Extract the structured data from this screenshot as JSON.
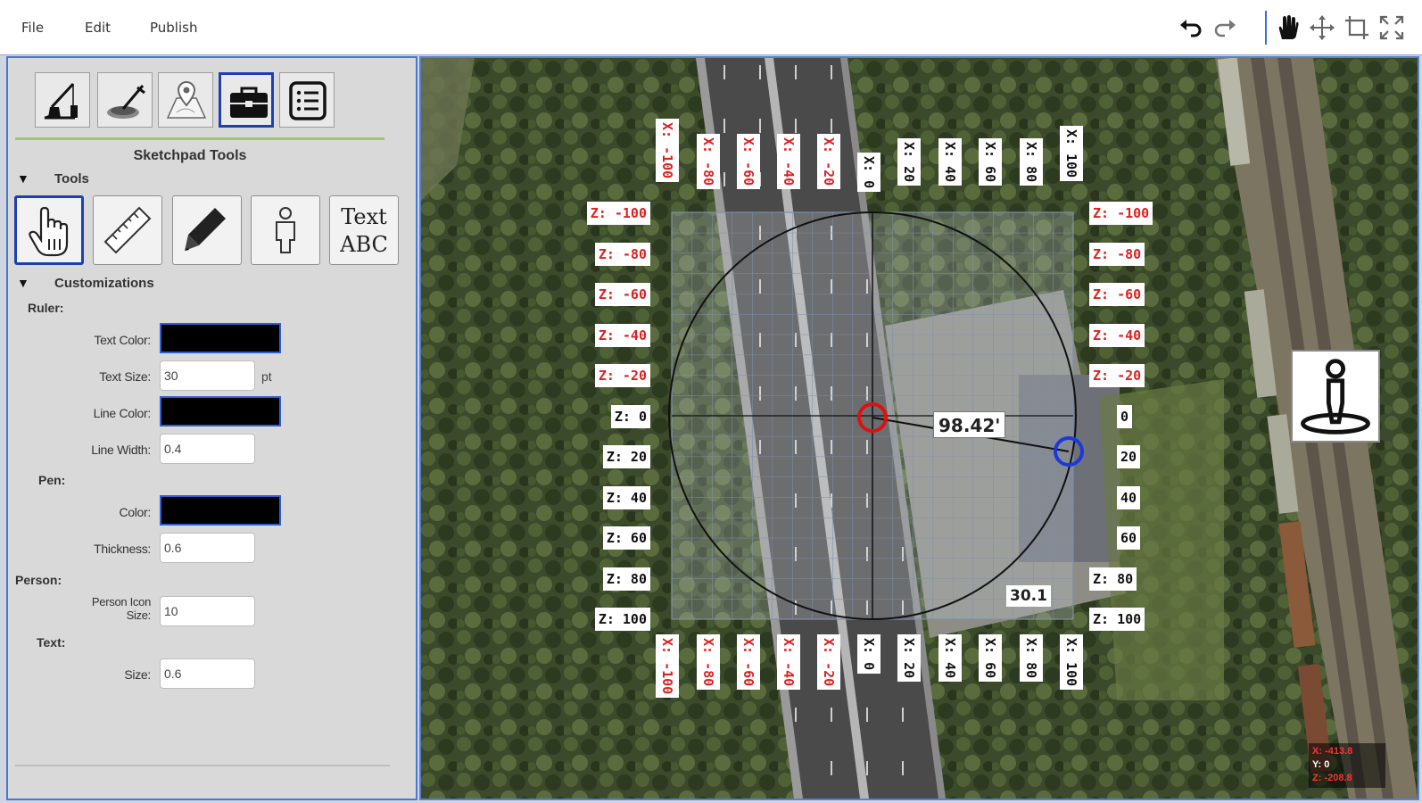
{
  "menu": {
    "file": "File",
    "edit": "Edit",
    "publish": "Publish"
  },
  "toolbar_icons": [
    "undo-icon",
    "redo-icon",
    "hand-pan-icon",
    "move-icon",
    "crop-icon",
    "fullscreen-icon"
  ],
  "panel": {
    "mode_buttons": [
      {
        "icon": "crane-icon",
        "active": false
      },
      {
        "icon": "metal-detector-icon",
        "active": false
      },
      {
        "icon": "map-pin-icon",
        "active": false
      },
      {
        "icon": "toolbox-icon",
        "active": true
      },
      {
        "icon": "list-icon",
        "active": false
      }
    ],
    "title": "Sketchpad Tools",
    "tools_heading": "Tools",
    "tools": [
      {
        "icon": "pointer-hand-icon",
        "active": true
      },
      {
        "icon": "ruler-icon",
        "active": false
      },
      {
        "icon": "pencil-icon",
        "active": false
      },
      {
        "icon": "person-icon",
        "active": false
      },
      {
        "text_line1": "Text",
        "text_line2": "ABC",
        "active": false
      }
    ],
    "customizations_heading": "Customizations",
    "ruler": {
      "label": "Ruler:",
      "text_color_label": "Text Color:",
      "text_color": "#000000",
      "text_size_label": "Text Size:",
      "text_size": "30",
      "text_size_unit": "pt",
      "line_color_label": "Line Color:",
      "line_color": "#000000",
      "line_width_label": "Line Width:",
      "line_width": "0.4"
    },
    "pen": {
      "label": "Pen:",
      "color_label": "Color:",
      "color": "#000000",
      "thickness_label": "Thickness:",
      "thickness": "0.6"
    },
    "person": {
      "label": "Person:",
      "icon_size_label_1": "Person Icon",
      "icon_size_label_2": "Size:",
      "icon_size": "10"
    },
    "text": {
      "label": "Text:",
      "size_label": "Size:",
      "size": "0.6"
    }
  },
  "map": {
    "x_labels": [
      "X: -100",
      "X: -80",
      "X: -60",
      "X: -40",
      "X: -20",
      "X: 0",
      "X: 20",
      "X: 40",
      "X: 60",
      "X: 80",
      "X: 100"
    ],
    "z_labels_left": [
      "Z: -100",
      "Z: -80",
      "Z: -60",
      "Z: -40",
      "Z: -20",
      "Z: 0",
      "Z: 20",
      "Z: 40",
      "Z: 60",
      "Z: 80",
      "Z: 100"
    ],
    "z_labels_right": [
      "Z: -100",
      "Z: -80",
      "Z: -60",
      "Z: -40",
      "Z: -20",
      "0",
      "20",
      "40",
      "60",
      "Z: 80",
      "Z: 100"
    ],
    "measurement": "98.42'",
    "radius_label": "30.1",
    "point_a_color": "#e01010",
    "point_b_color": "#1a3ad8",
    "person_tool_icon": "person-location-icon",
    "coords": {
      "x": "X: -413.8",
      "y": "Y: 0",
      "z": "Z: -208.8"
    }
  }
}
